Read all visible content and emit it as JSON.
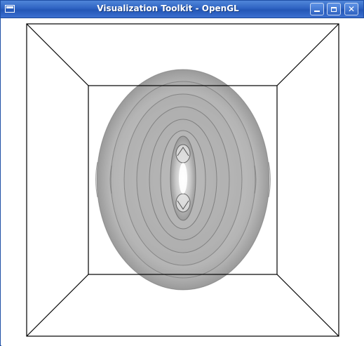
{
  "window": {
    "title": "Visualization Toolkit - OpenGL",
    "icons": {
      "app": "window-icon",
      "minimize": "minimize-icon",
      "maximize": "maximize-icon",
      "close": "close-icon"
    },
    "buttons": {
      "close_glyph": "✕"
    }
  },
  "scene": {
    "background_color": "#ffffff",
    "outline_color": "#000000",
    "surface_color": "#8a8a8a",
    "isosurface_count": 6
  }
}
